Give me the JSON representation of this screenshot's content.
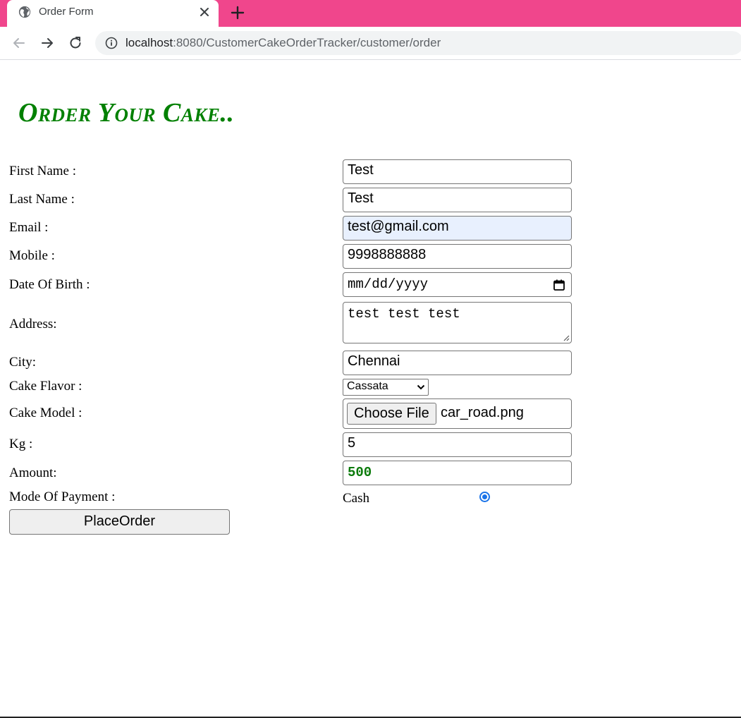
{
  "browser": {
    "tab_title": "Order Form",
    "url_host": "localhost",
    "url_rest": ":8080/CustomerCakeOrderTracker/customer/order",
    "accent_color": "#f0468c"
  },
  "form": {
    "title": "Order Your Cake..",
    "title_color": "#008000",
    "first_name": {
      "label": "First Name :",
      "value": "Test"
    },
    "last_name": {
      "label": "Last Name :",
      "value": "Test"
    },
    "email": {
      "label": "Email :",
      "value": "test@gmail.com"
    },
    "mobile": {
      "label": "Mobile :",
      "value": "9998888888"
    },
    "dob": {
      "label": "Date Of Birth :",
      "placeholder": "mm/dd/yyyy"
    },
    "address": {
      "label": "Address:",
      "value": "test test test"
    },
    "city": {
      "label": "City:",
      "value": "Chennai"
    },
    "flavor": {
      "label": "Cake Flavor :",
      "selected": "Cassata"
    },
    "model": {
      "label": "Cake Model :",
      "button": "Choose File",
      "file": "car_road.png"
    },
    "kg": {
      "label": "Kg :",
      "value": "5"
    },
    "amount": {
      "label": "Amount:",
      "value": "500"
    },
    "payment": {
      "label": "Mode Of Payment :",
      "option": "Cash",
      "selected": true
    },
    "submit_label": "PlaceOrder"
  }
}
